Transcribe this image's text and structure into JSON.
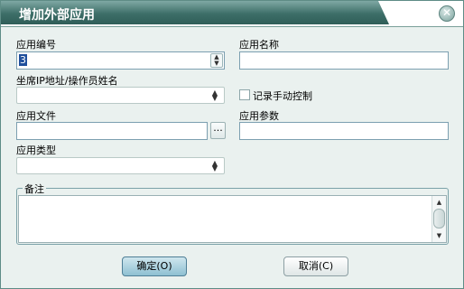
{
  "title": "增加外部应用",
  "close_icon": "close-icon",
  "labels": {
    "app_id": "应用编号",
    "app_name": "应用名称",
    "seat_ip": "坐席IP地址/操作员姓名",
    "record_manual": "记录手动控制",
    "app_file": "应用文件",
    "app_params": "应用参数",
    "app_type": "应用类型",
    "remarks": "备注"
  },
  "fields": {
    "app_id_value": "3",
    "browse_label": "..."
  },
  "buttons": {
    "ok": "确定(O)",
    "cancel": "取消(C)"
  },
  "colors": {
    "title_bar": "#3d6e68",
    "dialog_bg": "#eaf1ef",
    "accent_button": "#8ec0d2"
  }
}
